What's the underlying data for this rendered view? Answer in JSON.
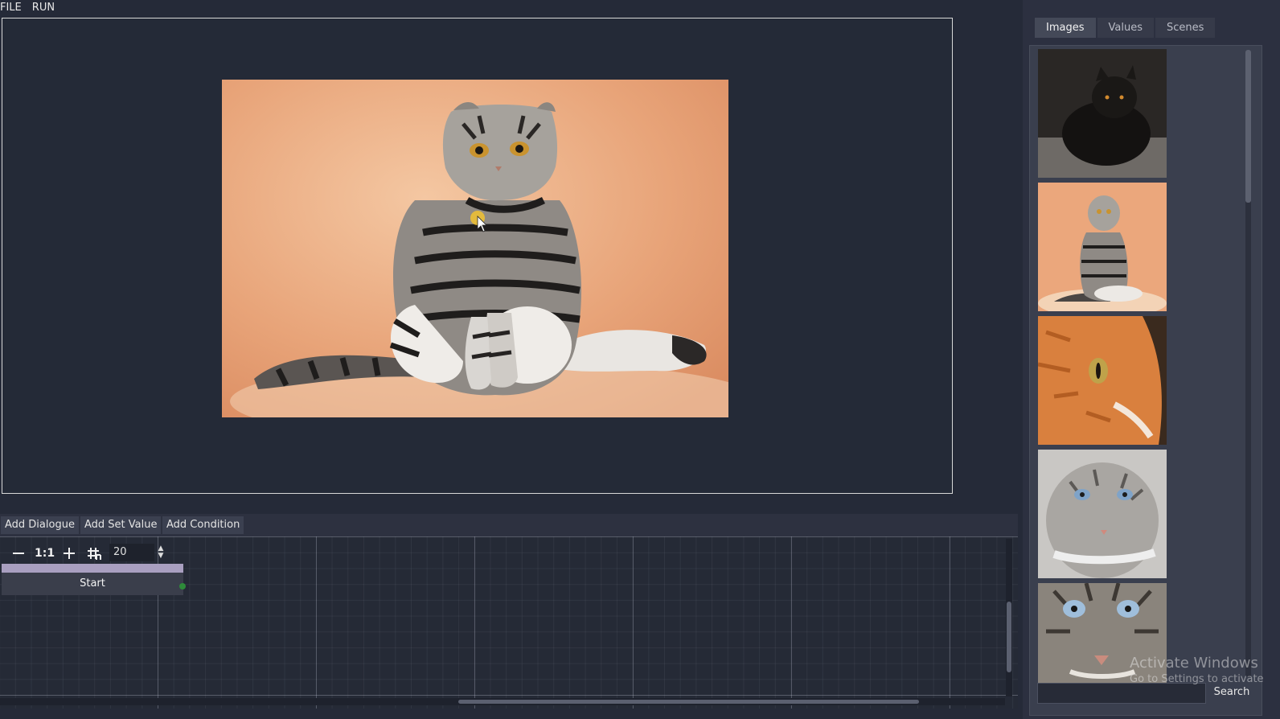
{
  "menu": {
    "items": [
      "FILE",
      "RUN"
    ]
  },
  "side_tabs": {
    "items": [
      "Images",
      "Values",
      "Scenes"
    ],
    "active": "Images"
  },
  "images_list": {
    "thumbnails": [
      "black-cat",
      "tabby-fold-cat",
      "orange-cat",
      "grey-longhair-cat",
      "tabby-cat-closeup"
    ]
  },
  "search": {
    "value": "",
    "button_label": "Search"
  },
  "graph_toolbar": {
    "add_dialogue": "Add Dialogue",
    "add_set_value": "Add Set Value",
    "add_condition": "Add Condition"
  },
  "graph_controls": {
    "zoom_reset_label": "1:1",
    "snap_value": "20"
  },
  "graph": {
    "start_node_label": "Start"
  },
  "watermark": {
    "line1": "Activate Windows",
    "line2": "Go to Settings to activate"
  },
  "colors": {
    "background": "#252a38",
    "node_header": "#a99fc0",
    "port": "#2e8b3a",
    "cursor_highlight": "#f2c230"
  }
}
